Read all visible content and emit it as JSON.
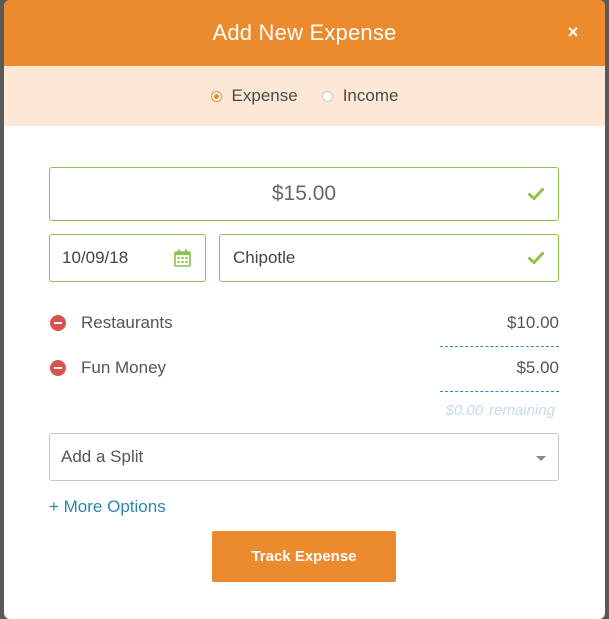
{
  "dialog": {
    "title": "Add New Expense",
    "close_label": "×"
  },
  "type_toggle": {
    "options": [
      {
        "label": "Expense",
        "selected": true
      },
      {
        "label": "Income",
        "selected": false
      }
    ]
  },
  "form": {
    "amount": "$15.00",
    "date": "10/09/18",
    "payee": "Chipotle",
    "splits": [
      {
        "category": "Restaurants",
        "amount": "$10.00"
      },
      {
        "category": "Fun Money",
        "amount": "$5.00"
      }
    ],
    "remaining_amount": "$0.00",
    "remaining_label": "remaining",
    "add_split_label": "Add a Split",
    "more_options_label": "+ More Options",
    "submit_label": "Track Expense"
  },
  "colors": {
    "accent": "#ec8a2e",
    "valid": "#8bc34a",
    "remove": "#d9534f",
    "link": "#2e86ab"
  }
}
